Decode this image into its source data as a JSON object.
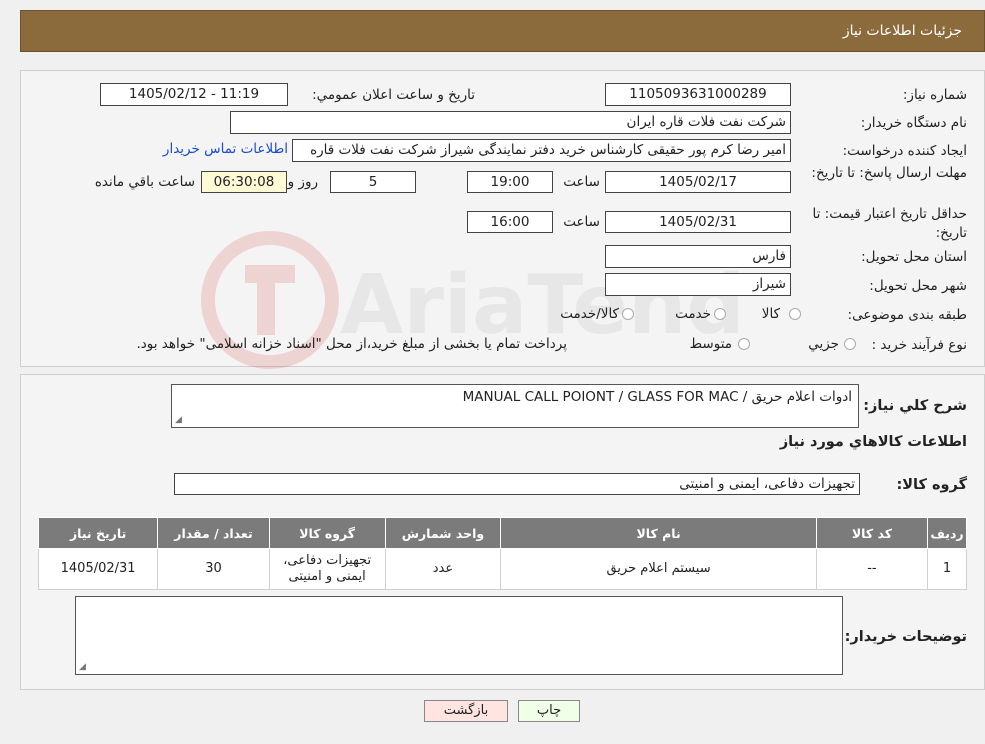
{
  "header": {
    "title": "جزئیات اطلاعات نیاز"
  },
  "fields": {
    "need_number_label": "شماره نیاز:",
    "need_number": "1105093631000289",
    "announce_label": "تاريخ و ساعت اعلان عمومي:",
    "announce_value": "1405/02/12 - 11:19",
    "buyer_org_label": "نام دستگاه خريدار:",
    "buyer_org": "شركت نفت فلات قاره ايران",
    "creator_label": "ايجاد كننده درخواست:",
    "creator": "امير رضا کرم پور حقيقی کارشناس خريد دفتر نمايندگی شيراز شركت نفت فلات قاره",
    "contact_link": "اطلاعات تماس خريدار",
    "reply_deadline_label": "مهلت ارسال پاسخ: تا تاریخ:",
    "reply_date": "1405/02/17",
    "time_label": "ساعت",
    "reply_time": "19:00",
    "days": "5",
    "days_label": "روز و",
    "remaining": "06:30:08",
    "remaining_label": "ساعت باقي مانده",
    "price_validity_label": "حداقل تاريخ اعتبار قيمت: تا تاریخ:",
    "validity_date": "1405/02/31",
    "validity_time": "16:00",
    "province_label": "استان محل تحويل:",
    "province": "فارس",
    "city_label": "شهر محل تحويل:",
    "city": "شيراز",
    "category_label": "طبقه بندی موضوعی:",
    "category_options": [
      "كالا",
      "خدمت",
      "كالا/خدمت"
    ],
    "process_label": "نوع فرآيند خريد :",
    "process_options": [
      "جزيي",
      "متوسط"
    ],
    "process_note": "پرداخت تمام يا بخشی از مبلغ خريد،از محل \"اسناد خزانه اسلامی\" خواهد بود."
  },
  "description": {
    "label": "شرح كلي نياز:",
    "value": "ادوات اعلام حريق / MANUAL CALL POIONT / GLASS FOR MAC"
  },
  "goods_info_title": "اطلاعات كالاهاي مورد نياز",
  "goods_group": {
    "label": "گروه كالا:",
    "value": "تجهيزات دفاعی، ايمنی و امنيتی"
  },
  "table": {
    "headers": [
      "رديف",
      "كد كالا",
      "نام كالا",
      "واحد شمارش",
      "گروه كالا",
      "تعداد / مقدار",
      "تاريخ نياز"
    ],
    "rows": [
      {
        "row": "1",
        "code": "--",
        "name": "سيستم اعلام حريق",
        "unit": "عدد",
        "group": "تجهيزات دفاعی، ايمنی و امنيتی",
        "qty": "30",
        "date": "1405/02/31"
      }
    ]
  },
  "buyer_notes_label": "توضيحات خريدار:",
  "buttons": {
    "print": "چاپ",
    "back": "بازگشت"
  },
  "watermark_text": "AriaTender.neT",
  "colors": {
    "header": "#8b6a3c",
    "back_button": "#ffe4e1",
    "print_button": "#f0ffe8",
    "link": "#1a4dc9"
  }
}
